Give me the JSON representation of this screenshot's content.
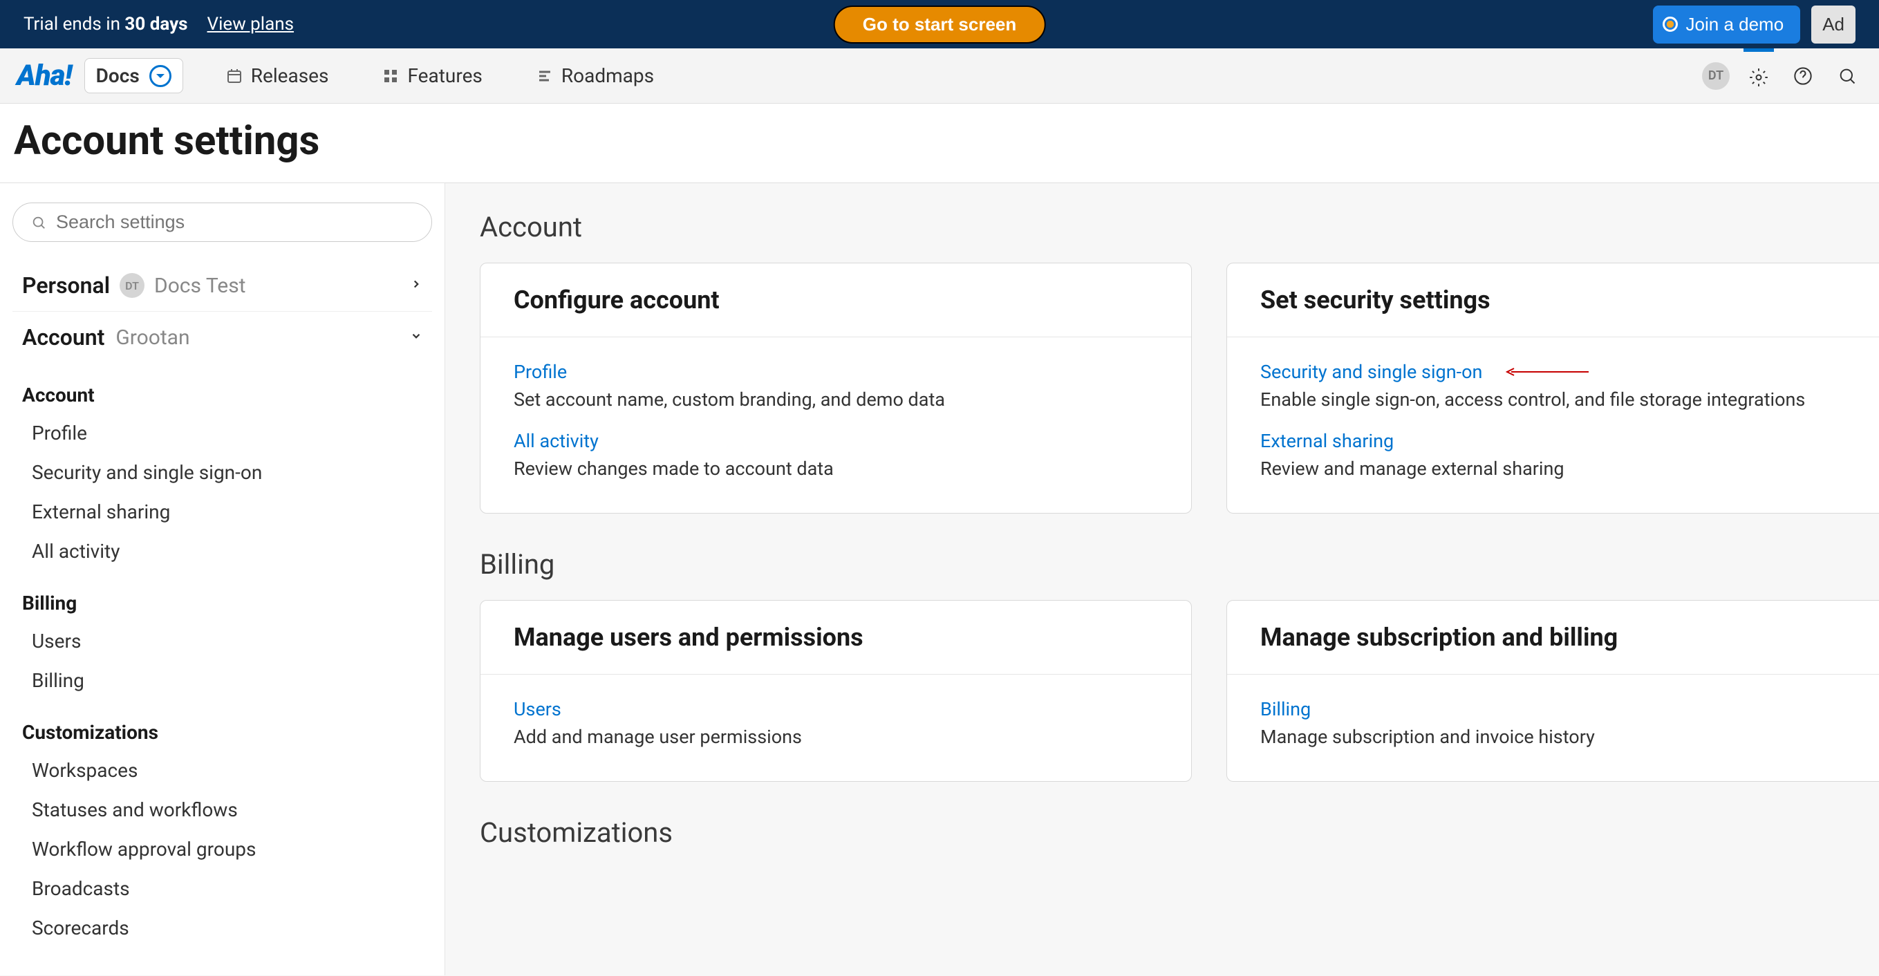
{
  "banner": {
    "trial_prefix": "Trial ends in ",
    "trial_days": "30 days",
    "view_plans": "View plans",
    "start_screen": "Go to start screen",
    "join_demo": "Join a demo",
    "add_btn": "Ad"
  },
  "topbar": {
    "logo": "Aha!",
    "docs": "Docs",
    "nav": {
      "releases": "Releases",
      "features": "Features",
      "roadmaps": "Roadmaps"
    },
    "avatar": "DT"
  },
  "page_title": "Account settings",
  "sidebar": {
    "search_placeholder": "Search settings",
    "personal": {
      "label": "Personal",
      "avatar": "DT",
      "sub": "Docs Test"
    },
    "account_scope": {
      "label": "Account",
      "sub": "Grootan"
    },
    "groups": [
      {
        "head": "Account",
        "items": [
          "Profile",
          "Security and single sign-on",
          "External sharing",
          "All activity"
        ]
      },
      {
        "head": "Billing",
        "items": [
          "Users",
          "Billing"
        ]
      },
      {
        "head": "Customizations",
        "items": [
          "Workspaces",
          "Statuses and workflows",
          "Workflow approval groups",
          "Broadcasts",
          "Scorecards"
        ]
      }
    ]
  },
  "main": {
    "sections": [
      {
        "title": "Account",
        "cards": [
          {
            "title": "Configure account",
            "items": [
              {
                "link": "Profile",
                "desc": "Set account name, custom branding, and demo data"
              },
              {
                "link": "All activity",
                "desc": "Review changes made to account data"
              }
            ]
          },
          {
            "title": "Set security settings",
            "items": [
              {
                "link": "Security and single sign-on",
                "desc": "Enable single sign-on, access control, and file storage integrations",
                "arrow": true
              },
              {
                "link": "External sharing",
                "desc": "Review and manage external sharing"
              }
            ]
          }
        ]
      },
      {
        "title": "Billing",
        "cards": [
          {
            "title": "Manage users and permissions",
            "items": [
              {
                "link": "Users",
                "desc": "Add and manage user permissions"
              }
            ]
          },
          {
            "title": "Manage subscription and billing",
            "items": [
              {
                "link": "Billing",
                "desc": "Manage subscription and invoice history"
              }
            ]
          }
        ]
      },
      {
        "title": "Customizations",
        "cards": []
      }
    ]
  }
}
